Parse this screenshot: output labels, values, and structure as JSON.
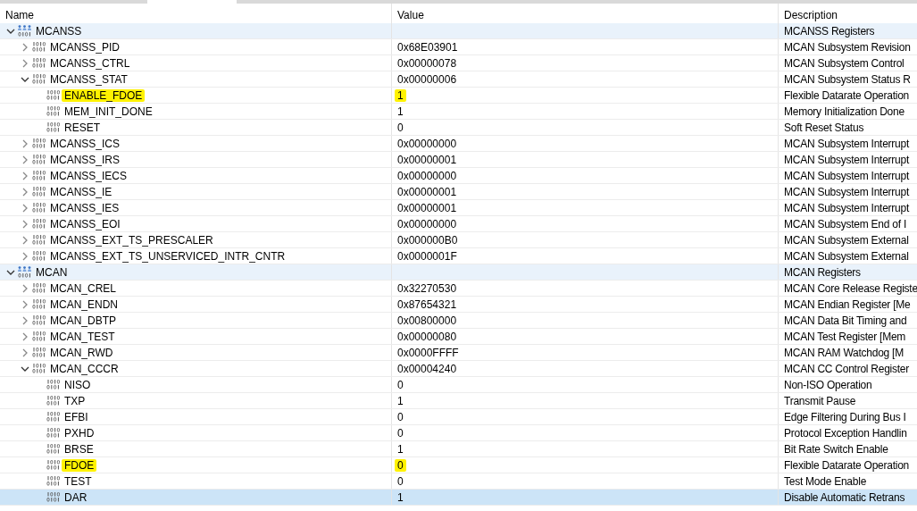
{
  "columns": [
    "Name",
    "Value",
    "Description"
  ],
  "tree": [
    {
      "kind": "group",
      "name": "MCANSS",
      "description": "MCANSS Registers",
      "expanded": true,
      "selected": false,
      "children": [
        {
          "kind": "register",
          "name": "MCANSS_PID",
          "value": "0x68E03901",
          "description": "MCAN Subsystem Revision",
          "expanded": false,
          "selected": false
        },
        {
          "kind": "register",
          "name": "MCANSS_CTRL",
          "value": "0x00000078",
          "description": "MCAN Subsystem Control",
          "expanded": false,
          "selected": false
        },
        {
          "kind": "register",
          "name": "MCANSS_STAT",
          "value": "0x00000006",
          "description": "MCAN Subsystem Status R",
          "expanded": true,
          "selected": false,
          "children": [
            {
              "kind": "field",
              "name": "ENABLE_FDOE",
              "value": "1",
              "description": "Flexible Datarate Operation",
              "highlighted": true,
              "selected": false
            },
            {
              "kind": "field",
              "name": "MEM_INIT_DONE",
              "value": "1",
              "description": "Memory Initialization Done",
              "highlighted": false,
              "selected": false
            },
            {
              "kind": "field",
              "name": "RESET",
              "value": "0",
              "description": "Soft Reset Status",
              "highlighted": false,
              "selected": false
            }
          ]
        },
        {
          "kind": "register",
          "name": "MCANSS_ICS",
          "value": "0x00000000",
          "description": "MCAN Subsystem Interrupt",
          "expanded": false,
          "selected": false
        },
        {
          "kind": "register",
          "name": "MCANSS_IRS",
          "value": "0x00000001",
          "description": "MCAN Subsystem Interrupt",
          "expanded": false,
          "selected": false
        },
        {
          "kind": "register",
          "name": "MCANSS_IECS",
          "value": "0x00000000",
          "description": "MCAN Subsystem Interrupt",
          "expanded": false,
          "selected": false
        },
        {
          "kind": "register",
          "name": "MCANSS_IE",
          "value": "0x00000001",
          "description": "MCAN Subsystem Interrupt",
          "expanded": false,
          "selected": false
        },
        {
          "kind": "register",
          "name": "MCANSS_IES",
          "value": "0x00000001",
          "description": "MCAN Subsystem Interrupt",
          "expanded": false,
          "selected": false
        },
        {
          "kind": "register",
          "name": "MCANSS_EOI",
          "value": "0x00000000",
          "description": "MCAN Subsystem End of I",
          "expanded": false,
          "selected": false
        },
        {
          "kind": "register",
          "name": "MCANSS_EXT_TS_PRESCALER",
          "value": "0x000000B0",
          "description": "MCAN Subsystem External",
          "expanded": false,
          "selected": false
        },
        {
          "kind": "register",
          "name": "MCANSS_EXT_TS_UNSERVICED_INTR_CNTR",
          "value": "0x0000001F",
          "description": "MCAN Subsystem External",
          "expanded": false,
          "selected": false
        }
      ]
    },
    {
      "kind": "group",
      "name": "MCAN",
      "description": "MCAN Registers",
      "expanded": true,
      "selected": false,
      "children": [
        {
          "kind": "register",
          "name": "MCAN_CREL",
          "value": "0x32270530",
          "description": "MCAN Core Release Registe",
          "expanded": false,
          "selected": false
        },
        {
          "kind": "register",
          "name": "MCAN_ENDN",
          "value": "0x87654321",
          "description": "MCAN Endian Register [Me",
          "expanded": false,
          "selected": false
        },
        {
          "kind": "register",
          "name": "MCAN_DBTP",
          "value": "0x00800000",
          "description": "MCAN Data Bit Timing and",
          "expanded": false,
          "selected": false
        },
        {
          "kind": "register",
          "name": "MCAN_TEST",
          "value": "0x00000080",
          "description": "MCAN Test Register [Mem",
          "expanded": false,
          "selected": false
        },
        {
          "kind": "register",
          "name": "MCAN_RWD",
          "value": "0x0000FFFF",
          "description": "MCAN RAM Watchdog [M",
          "expanded": false,
          "selected": false
        },
        {
          "kind": "register",
          "name": "MCAN_CCCR",
          "value": "0x00004240",
          "description": "MCAN CC Control Register",
          "expanded": true,
          "selected": false,
          "children": [
            {
              "kind": "field",
              "name": "NISO",
              "value": "0",
              "description": "Non-ISO Operation",
              "highlighted": false,
              "selected": false
            },
            {
              "kind": "field",
              "name": "TXP",
              "value": "1",
              "description": "Transmit Pause",
              "highlighted": false,
              "selected": false
            },
            {
              "kind": "field",
              "name": "EFBI",
              "value": "0",
              "description": "Edge Filtering During Bus I",
              "highlighted": false,
              "selected": false
            },
            {
              "kind": "field",
              "name": "PXHD",
              "value": "0",
              "description": "Protocol Exception Handlin",
              "highlighted": false,
              "selected": false
            },
            {
              "kind": "field",
              "name": "BRSE",
              "value": "1",
              "description": "Bit Rate Switch Enable",
              "highlighted": false,
              "selected": false
            },
            {
              "kind": "field",
              "name": "FDOE",
              "value": "0",
              "description": "Flexible Datarate Operation",
              "highlighted": true,
              "selected": false
            },
            {
              "kind": "field",
              "name": "TEST",
              "value": "0",
              "description": "Test Mode Enable",
              "highlighted": false,
              "selected": false
            },
            {
              "kind": "field",
              "name": "DAR",
              "value": "1",
              "description": "Disable Automatic Retrans",
              "highlighted": false,
              "selected": true
            }
          ]
        }
      ]
    }
  ]
}
